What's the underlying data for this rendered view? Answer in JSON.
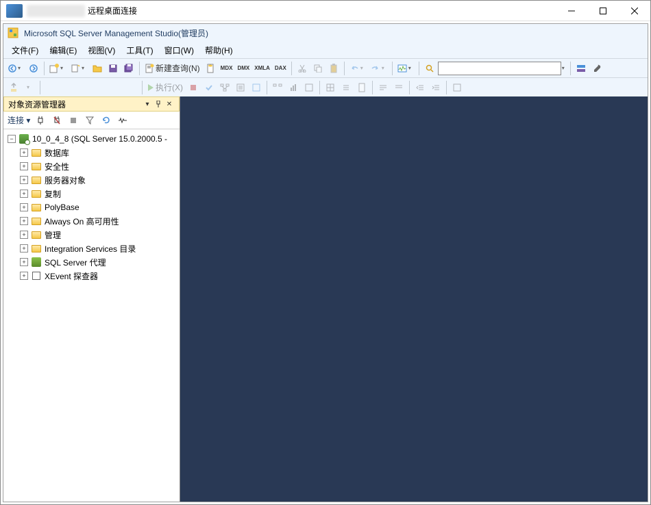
{
  "titlebar": {
    "suffix": "远程桌面连接"
  },
  "app": {
    "title": "Microsoft SQL Server Management Studio(管理员)"
  },
  "menu": {
    "file": "文件(F)",
    "edit": "编辑(E)",
    "view": "视图(V)",
    "tools": "工具(T)",
    "window": "窗口(W)",
    "help": "帮助(H)"
  },
  "toolbar": {
    "new_query": "新建查询(N)",
    "execute": "执行(X)",
    "search_value": ""
  },
  "panel": {
    "title": "对象资源管理器",
    "connect_label": "连接"
  },
  "tree": {
    "root": "10_0_4_8 (SQL Server 15.0.2000.5 -",
    "items": [
      {
        "label": "数据库",
        "icon": "folder"
      },
      {
        "label": "安全性",
        "icon": "folder"
      },
      {
        "label": "服务器对象",
        "icon": "folder"
      },
      {
        "label": "复制",
        "icon": "folder"
      },
      {
        "label": "PolyBase",
        "icon": "folder"
      },
      {
        "label": "Always On 高可用性",
        "icon": "folder"
      },
      {
        "label": "管理",
        "icon": "folder"
      },
      {
        "label": "Integration Services 目录",
        "icon": "folder"
      },
      {
        "label": "SQL Server 代理",
        "icon": "agent"
      },
      {
        "label": "XEvent 探查器",
        "icon": "xevent"
      }
    ]
  }
}
